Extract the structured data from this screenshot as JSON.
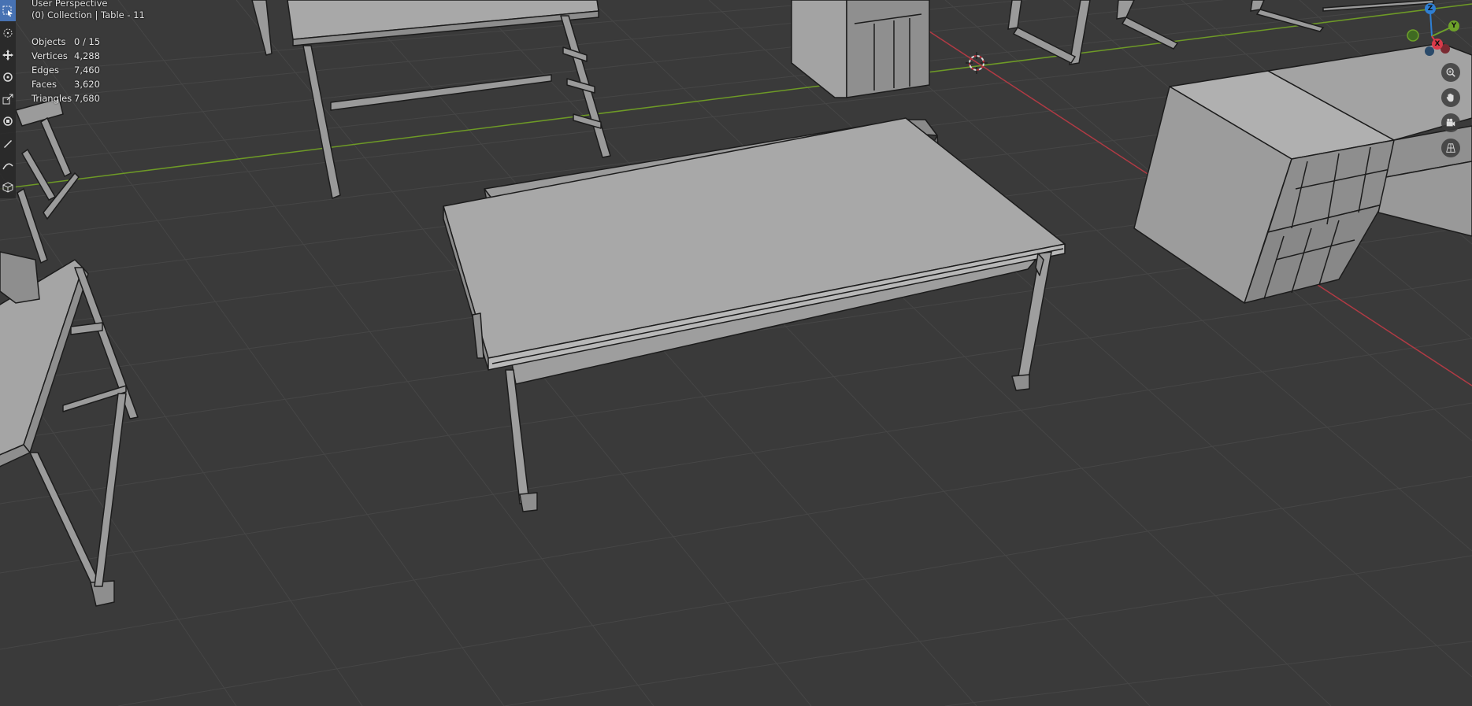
{
  "viewport": {
    "header_line1": "User Perspective",
    "header_line2": "(0) Collection | Table - 11"
  },
  "stats": [
    {
      "label": "Objects",
      "value": "0 / 15"
    },
    {
      "label": "Vertices",
      "value": "4,288"
    },
    {
      "label": "Edges",
      "value": "7,460"
    },
    {
      "label": "Faces",
      "value": "3,620"
    },
    {
      "label": "Triangles",
      "value": "7,680"
    }
  ],
  "gizmo": {
    "z_label": "Z",
    "y_label": "Y",
    "x_label": "X",
    "z_color": "#2f7fd3",
    "y_color": "#6ea12a",
    "x_color": "#d93a4a"
  },
  "toolbar": {
    "tools": [
      {
        "icon": "select-box-icon",
        "active": true
      },
      {
        "icon": "cursor-icon",
        "active": false
      },
      {
        "icon": "move-icon",
        "active": false
      },
      {
        "icon": "rotate-icon",
        "active": false
      },
      {
        "icon": "scale-icon",
        "active": false
      },
      {
        "icon": "transform-icon",
        "active": false
      },
      {
        "icon": "annotate-icon",
        "active": false
      },
      {
        "icon": "measure-icon",
        "active": false
      },
      {
        "icon": "add-cube-icon",
        "active": false
      }
    ]
  },
  "nav_buttons": [
    "zoom-icon",
    "hand-pan-icon",
    "camera-icon",
    "grid-perspective-icon"
  ],
  "colors": {
    "background": "#3a3a3a",
    "grid_line": "#454545",
    "x_axis": "#b03a44",
    "y_axis": "#6e9a26",
    "object_fill": "#a6a6a6",
    "object_edge": "#1c1c1c",
    "toolbar_active": "#4772b3"
  }
}
